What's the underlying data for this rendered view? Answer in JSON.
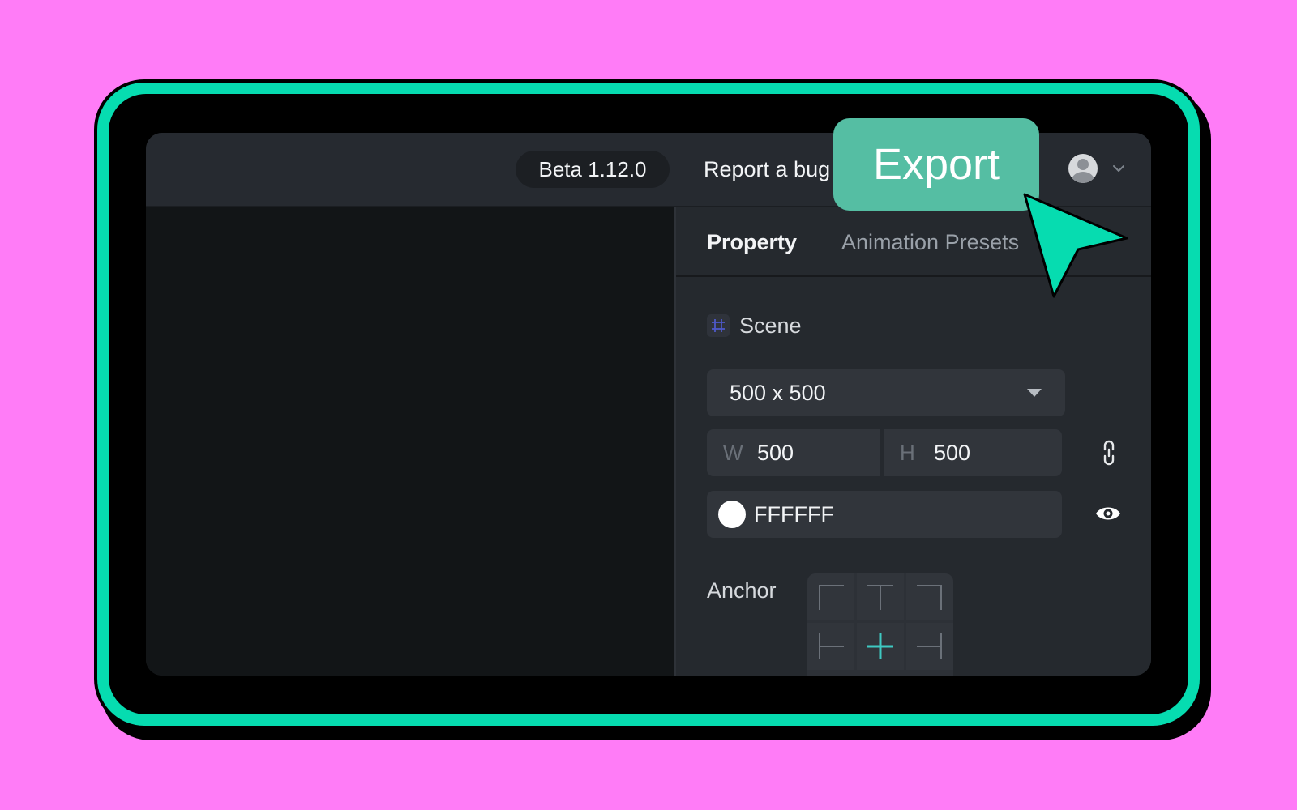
{
  "topbar": {
    "version": "Beta 1.12.0",
    "report_bug": "Report a bug",
    "export": "Export"
  },
  "panel": {
    "tabs": [
      {
        "label": "Property",
        "active": true
      },
      {
        "label": "Animation Presets",
        "active": false
      }
    ],
    "scene_label": "Scene",
    "size_preset": "500 x 500",
    "width_letter": "W",
    "width_value": "500",
    "height_letter": "H",
    "height_value": "500",
    "background_color": "FFFFFF",
    "anchor_label": "Anchor"
  },
  "colors": {
    "page_background": "#ff7cf7",
    "frame_accent": "#06dcb0",
    "export_button": "#55bea3",
    "cursor": "#06dcb0"
  },
  "icons": [
    "scene-frame-icon",
    "chevron-down-icon",
    "caret-down-icon",
    "link-icon",
    "eye-icon",
    "avatar-icon",
    "cursor-icon"
  ]
}
